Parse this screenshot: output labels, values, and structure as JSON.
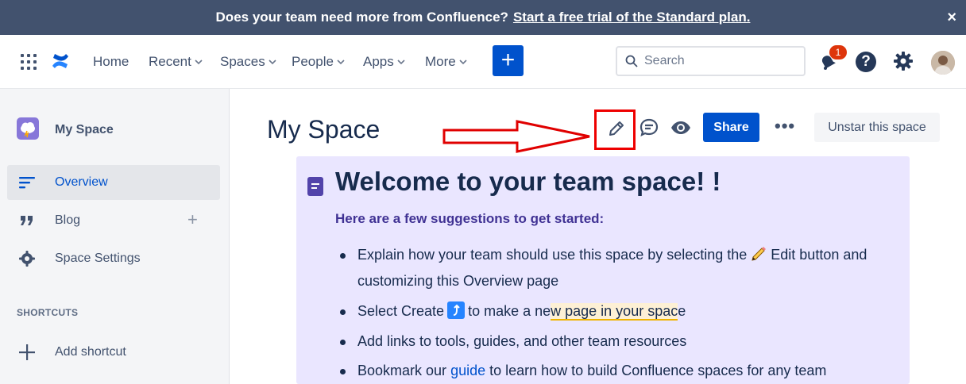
{
  "banner": {
    "text": "Does your team need more from Confluence?",
    "link": "Start a free trial of the Standard plan.",
    "close": "×"
  },
  "nav": {
    "items": [
      "Home",
      "Recent",
      "Spaces",
      "People",
      "Apps",
      "More"
    ],
    "create_label": "+",
    "search_placeholder": "Search",
    "notification_count": "1",
    "help_label": "?"
  },
  "sidebar": {
    "space_name": "My Space",
    "items": [
      {
        "label": "Overview",
        "icon": "overview-lines-icon",
        "active": true
      },
      {
        "label": "Blog",
        "icon": "quote-icon",
        "active": false
      },
      {
        "label": "Space Settings",
        "icon": "gear-icon",
        "active": false
      }
    ],
    "shortcuts_heading": "SHORTCUTS",
    "add_shortcut": "Add shortcut"
  },
  "page": {
    "title": "My Space",
    "share_label": "Share",
    "more_label": "•••",
    "unstar_label": "Unstar this space"
  },
  "panel": {
    "title": "Welcome to your team space! !",
    "subtitle": "Here are a few suggestions to get started:",
    "bullet1_a": "Explain how your team should use this space by selecting the",
    "bullet1_b": "Edit button and customizing this Overview page",
    "bullet2_a": "Select Create",
    "bullet2_b": "to make a ne",
    "bullet2_hl": "w page in your spac",
    "bullet2_c": "e",
    "bullet3": "Add links to tools, guides, and other team resources",
    "bullet4_a": "Bookmark our",
    "bullet4_link": "guide",
    "bullet4_b": "to learn how to build Confluence spaces for any team"
  },
  "colors": {
    "banner_bg": "#42526e",
    "primary": "#0052cc",
    "annotation_red": "#e00000",
    "panel_bg": "#eae6ff"
  }
}
